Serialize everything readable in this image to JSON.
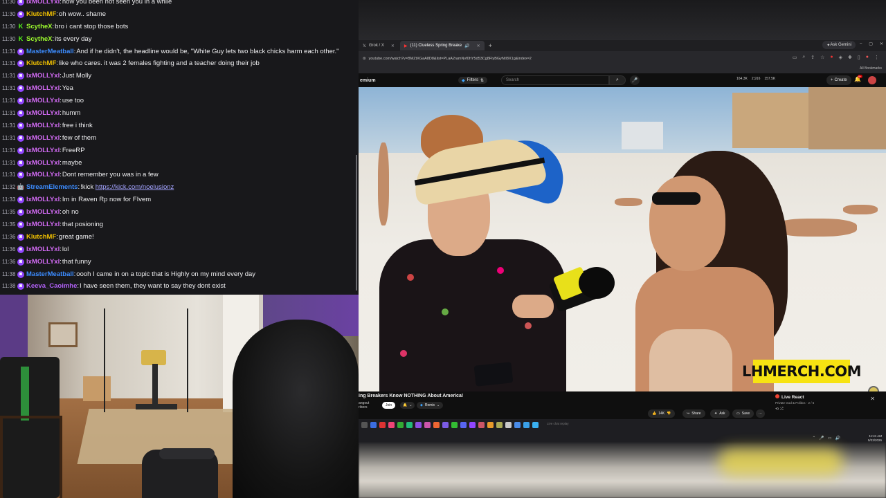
{
  "chat": {
    "messages": [
      {
        "time": "11:30",
        "badge": "twitch",
        "user": "lxMOLLYxl",
        "color": "#d36bf5",
        "text": "how you been not seen you in a while"
      },
      {
        "time": "11:30",
        "badge": "twitch",
        "user": "KlutchMF",
        "color": "#f0c000",
        "text": "oh wow.. shame"
      },
      {
        "time": "11:30",
        "badge": "kick",
        "user": "ScytheX",
        "color": "#9dfc2e",
        "text": "bro i cant stop those bots"
      },
      {
        "time": "11:30",
        "badge": "kick",
        "user": "ScytheX",
        "color": "#9dfc2e",
        "text": "its every day"
      },
      {
        "time": "11:31",
        "badge": "twitch",
        "user": "MasterMeatball",
        "color": "#3c8cff",
        "text": "And if he didn't, the headline would be, \"White Guy lets two black chicks harm each other.\""
      },
      {
        "time": "11:31",
        "badge": "twitch",
        "user": "KlutchMF",
        "color": "#f0c000",
        "text": "like who cares. it was 2 females fighting and a teacher doing their job"
      },
      {
        "time": "11:31",
        "badge": "twitch",
        "user": "lxMOLLYxl",
        "color": "#d36bf5",
        "text": "Just Molly"
      },
      {
        "time": "11:31",
        "badge": "twitch",
        "user": "lxMOLLYxl",
        "color": "#d36bf5",
        "text": "Yea"
      },
      {
        "time": "11:31",
        "badge": "twitch",
        "user": "lxMOLLYxl",
        "color": "#d36bf5",
        "text": "use too"
      },
      {
        "time": "11:31",
        "badge": "twitch",
        "user": "lxMOLLYxl",
        "color": "#d36bf5",
        "text": "humm"
      },
      {
        "time": "11:31",
        "badge": "twitch",
        "user": "lxMOLLYxl",
        "color": "#d36bf5",
        "text": "free i think"
      },
      {
        "time": "11:31",
        "badge": "twitch",
        "user": "lxMOLLYxl",
        "color": "#d36bf5",
        "text": "few of them"
      },
      {
        "time": "11:31",
        "badge": "twitch",
        "user": "lxMOLLYxl",
        "color": "#d36bf5",
        "text": "FreeRP"
      },
      {
        "time": "11:31",
        "badge": "twitch",
        "user": "lxMOLLYxl",
        "color": "#d36bf5",
        "text": "maybe"
      },
      {
        "time": "11:31",
        "badge": "twitch",
        "user": "lxMOLLYxl",
        "color": "#d36bf5",
        "text": "Dont remember you was in a few"
      },
      {
        "time": "11:32",
        "badge": "bot",
        "user": "StreamElements",
        "color": "#3c8cff",
        "text": "!kick ",
        "link": "https://kick.com/noelusionz"
      },
      {
        "time": "11:33",
        "badge": "twitch",
        "user": "lxMOLLYxl",
        "color": "#d36bf5",
        "text": "Im in Raven Rp now for FIvem"
      },
      {
        "time": "11:35",
        "badge": "twitch",
        "user": "lxMOLLYxl",
        "color": "#d36bf5",
        "text": "oh no"
      },
      {
        "time": "11:35",
        "badge": "twitch",
        "user": "lxMOLLYxl",
        "color": "#d36bf5",
        "text": "that posioning"
      },
      {
        "time": "11:36",
        "badge": "twitch",
        "user": "KlutchMF",
        "color": "#f0c000",
        "text": "great game!"
      },
      {
        "time": "11:36",
        "badge": "twitch",
        "user": "lxMOLLYxl",
        "color": "#d36bf5",
        "text": "lol"
      },
      {
        "time": "11:36",
        "badge": "twitch",
        "user": "lxMOLLYxl",
        "color": "#d36bf5",
        "text": "that funny"
      },
      {
        "time": "11:38",
        "badge": "twitch",
        "user": "MasterMeatball",
        "color": "#3c8cff",
        "text": "oooh I came in on a topic that is Highly on my mind every day"
      },
      {
        "time": "11:38",
        "badge": "twitch",
        "user": "Keeva_Caoimhe",
        "color": "#b061f5",
        "text": "I have seen them, they want to say they dont exist"
      }
    ]
  },
  "browser": {
    "tabs": [
      {
        "label": "Grok / X",
        "icon": "x-logo-icon",
        "active": false
      },
      {
        "label": "(11) Clueless Spring Breake",
        "icon": "youtube-icon",
        "active": true
      }
    ],
    "ask_gemini": "Ask Gemini",
    "url": "youtube.com/watch?v=BMZtXGaA8D8&list=PLaA2ramNvf0hY5d53Cg8FlyBGyNtI8X1g&index=2",
    "all_bookmarks": "All Bookmarks"
  },
  "youtube": {
    "logo_text": "emium",
    "filters_label": "Filters",
    "search_placeholder": "Search",
    "stats": [
      "164.3K",
      "2,916",
      "157.5K"
    ],
    "create_label": "Create",
    "notifications": "9+",
    "video_overlay": "LHMERCH.COM",
    "video_title": "ing Breakers Know NOTHING About America!",
    "channel_line1": "angout",
    "channel_line2": "ribers",
    "join_label": "Join",
    "remix_label": "Remix",
    "likes": "14K",
    "share_label": "Share",
    "ask_label": "Ask",
    "save_label": "Save",
    "live_react_title": "Live React",
    "live_react_sub": "Private God & Politics · 2 / 5",
    "live_chat_hint": "Live chat replay"
  },
  "taskbar": {
    "time": "11:41 AM",
    "date": "5/23/2026"
  },
  "colors": {
    "chat_bg": "#18181b",
    "twitch_purple": "#9146ff",
    "kick_green": "#53fc18",
    "youtube_bg": "#0f0f0f",
    "overlay_yellow": "#f7e312"
  }
}
